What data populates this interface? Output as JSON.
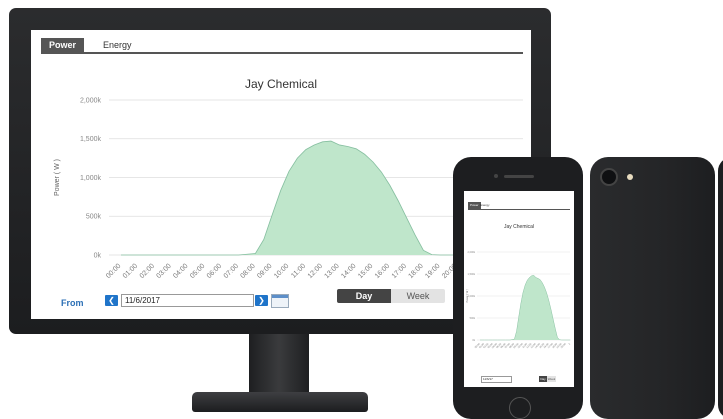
{
  "desktop": {
    "tabs": [
      {
        "label": "Power",
        "active": true
      },
      {
        "label": "Energy",
        "active": false
      }
    ],
    "title": "Jay Chemical",
    "controls": {
      "from_label": "From",
      "prev_icon": "chevron-left-icon",
      "next_icon": "chevron-right-icon",
      "date_value": "11/6/2017",
      "calendar_icon": "calendar-icon",
      "period_buttons": [
        "Day",
        "Week"
      ],
      "selected_period": "Day"
    }
  },
  "chart_data": {
    "type": "area",
    "title": "Jay Chemical",
    "ylabel": "Power ( W )",
    "xlabel": "",
    "ylim": [
      0,
      2000000
    ],
    "y_ticks": [
      "0k",
      "500k",
      "1,000k",
      "1,500k",
      "2,000k"
    ],
    "x_ticks": [
      "00:00",
      "01:00",
      "02:00",
      "03:00",
      "04:00",
      "05:00",
      "06:00",
      "07:00",
      "08:00",
      "09:00",
      "10:00",
      "11:00",
      "12:00",
      "13:00",
      "14:00",
      "15:00",
      "16:00",
      "17:00",
      "18:00",
      "19:00",
      "20:00",
      "2"
    ],
    "x": [
      0,
      1,
      2,
      3,
      4,
      5,
      6,
      7,
      8,
      8.5,
      9,
      9.5,
      10,
      10.5,
      11,
      11.5,
      12,
      12.5,
      13,
      13.5,
      14,
      14.5,
      15,
      15.5,
      16,
      16.5,
      17,
      17.5,
      18,
      18.5,
      19,
      20,
      21
    ],
    "values": [
      0,
      0,
      0,
      0,
      0,
      0,
      0,
      0,
      20000,
      200000,
      520000,
      830000,
      1080000,
      1250000,
      1360000,
      1420000,
      1460000,
      1470000,
      1420000,
      1400000,
      1370000,
      1300000,
      1200000,
      1070000,
      900000,
      700000,
      480000,
      260000,
      60000,
      5000,
      0,
      0,
      0
    ],
    "grid": true,
    "legend": "none",
    "fill_color": "#bfe6cb",
    "line_color": "#86bfa0"
  },
  "mobile": {
    "tabs": [
      {
        "label": "Power",
        "active": true
      },
      {
        "label": "Energy",
        "active": false
      }
    ],
    "title": "Jay Chemical",
    "date_value": "11/6/17",
    "period_buttons": [
      "Day",
      "Week"
    ]
  },
  "colors": {
    "accent": "#1f74c9",
    "monitor_bezel": "#1e1f21"
  }
}
